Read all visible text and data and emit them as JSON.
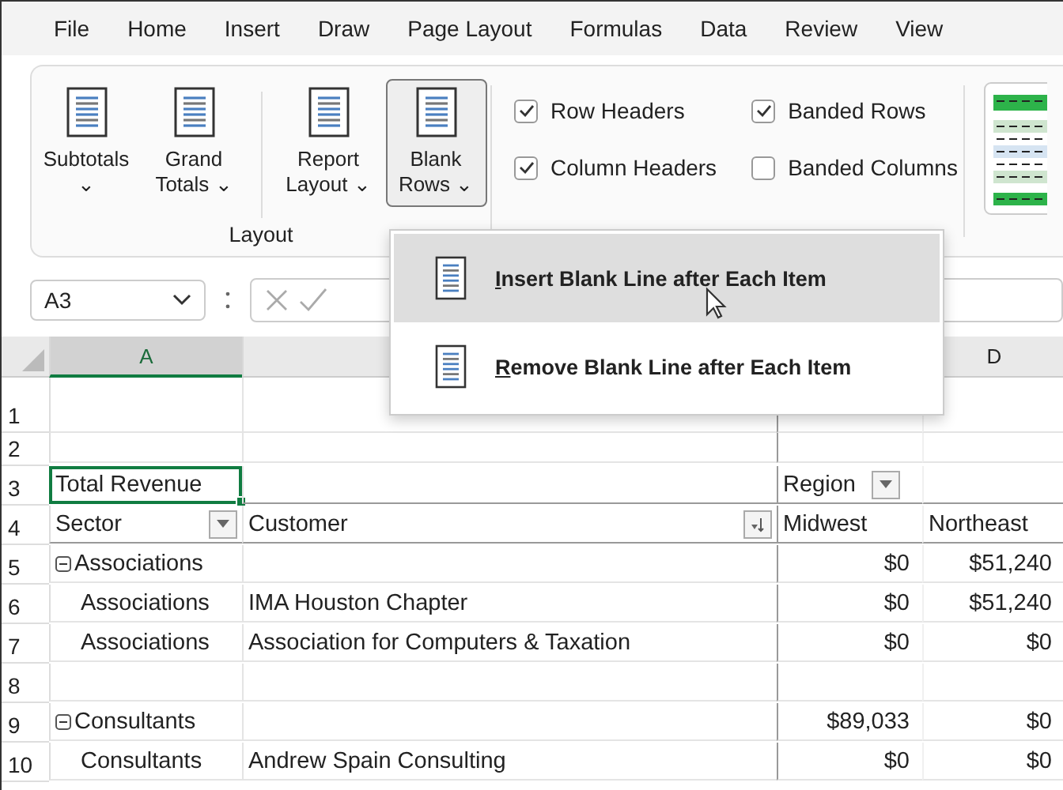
{
  "menu_tabs": [
    {
      "label": "File",
      "selected": false
    },
    {
      "label": "Home",
      "selected": false
    },
    {
      "label": "Insert",
      "selected": false
    },
    {
      "label": "Draw",
      "selected": false
    },
    {
      "label": "Page Layout",
      "selected": false
    },
    {
      "label": "Formulas",
      "selected": false
    },
    {
      "label": "Data",
      "selected": false
    },
    {
      "label": "Review",
      "selected": false
    },
    {
      "label": "View",
      "selected": false
    }
  ],
  "ribbon": {
    "layout_group": {
      "label": "Layout",
      "buttons": [
        {
          "label": "Subtotals",
          "caret": "⌄",
          "expanded": false
        },
        {
          "label": "Grand Totals",
          "caret": "⌄",
          "expanded": false
        },
        {
          "label": "Report Layout",
          "caret": "⌄",
          "expanded": false
        },
        {
          "label": "Blank Rows",
          "caret": "⌄",
          "expanded": true
        }
      ]
    },
    "style_options": [
      {
        "label": "Row Headers",
        "checked": true
      },
      {
        "label": "Banded Rows",
        "checked": true
      },
      {
        "label": "Column Headers",
        "checked": true
      },
      {
        "label": "Banded Columns",
        "checked": false
      }
    ]
  },
  "dropdown_menu": [
    {
      "label": "Insert Blank Line after Each Item",
      "selected": true
    },
    {
      "label": "Remove Blank Line after Each Item",
      "selected": false
    }
  ],
  "formula_bar": {
    "name_box": "A3"
  },
  "sheet": {
    "columns": [
      {
        "label": "A",
        "selected": true
      },
      {},
      {
        "label": "D",
        "selected": false
      }
    ],
    "rows": [
      {
        "num": "1",
        "cells": []
      },
      {
        "num": "2",
        "cells": []
      },
      {
        "num": "3",
        "cells": [
          {
            "text": "Total Revenue",
            "selected": true
          },
          {},
          {
            "text": "Region",
            "filter": true
          },
          {}
        ]
      },
      {
        "num": "4",
        "cells": [
          {
            "text": "Sector",
            "filter": true
          },
          {
            "text": "Customer",
            "sort": true
          },
          {
            "text": "Midwest"
          },
          {
            "text": "Northeast"
          }
        ]
      },
      {
        "num": "5",
        "cells": [
          {
            "text": "Associations",
            "collapse": true
          },
          {},
          {
            "text": "$0",
            "num": true
          },
          {
            "text": "$51,240",
            "num": true
          }
        ]
      },
      {
        "num": "6",
        "cells": [
          {
            "text": "Associations",
            "indent": true
          },
          {
            "text": "IMA Houston Chapter"
          },
          {
            "text": "$0",
            "num": true
          },
          {
            "text": "$51,240",
            "num": true
          }
        ]
      },
      {
        "num": "7",
        "cells": [
          {
            "text": "Associations",
            "indent": true
          },
          {
            "text": "Association for Computers & Taxation"
          },
          {
            "text": "$0",
            "num": true
          },
          {
            "text": "$0",
            "num": true
          }
        ]
      },
      {
        "num": "8",
        "cells": []
      },
      {
        "num": "9",
        "cells": [
          {
            "text": "Consultants",
            "collapse": true
          },
          {},
          {
            "text": "$89,033",
            "num": true
          },
          {
            "text": "$0",
            "num": true
          }
        ]
      },
      {
        "num": "10",
        "cells": [
          {
            "text": "Consultants",
            "indent": true
          },
          {
            "text": "Andrew Spain Consulting"
          },
          {
            "text": "$0",
            "num": true
          },
          {
            "text": "$0",
            "num": true
          }
        ]
      }
    ]
  }
}
